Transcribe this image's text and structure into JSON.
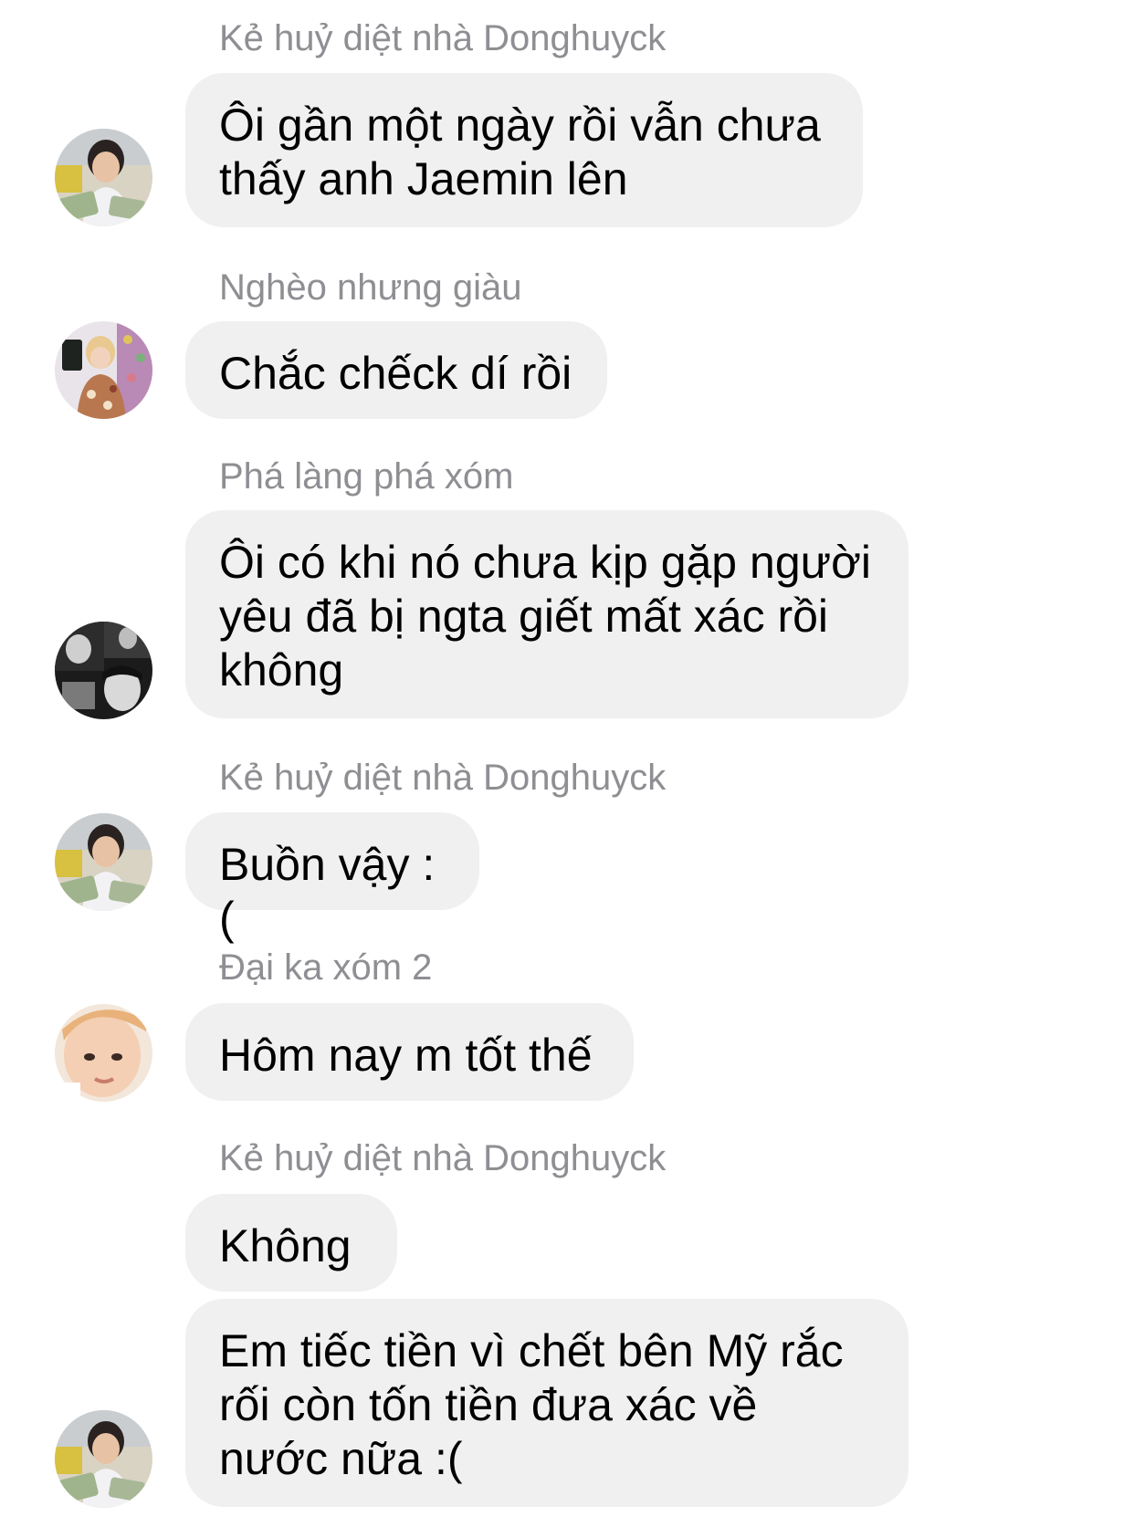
{
  "messages": [
    {
      "sender": "Kẻ huỷ diệt nhà Donghuyck",
      "avatar": "avatar-boy-with-money",
      "bubbles": [
        "Ôi gần một ngày rồi vẫn chưa thấy anh Jaemin lên"
      ]
    },
    {
      "sender": "Nghèo nhưng giàu",
      "avatar": "avatar-idol-floral-shirt",
      "bubbles": [
        "Chắc chếck dí rồi"
      ]
    },
    {
      "sender": "Phá làng phá xóm",
      "avatar": "avatar-bw-collage",
      "bubbles": [
        "Ôi có khi nó chưa kịp gặp người yêu đã bị ngta giết mất xác rồi không"
      ]
    },
    {
      "sender": "Kẻ huỷ diệt nhà Donghuyck",
      "avatar": "avatar-boy-with-money",
      "bubbles": [
        "Buồn vậy :("
      ]
    },
    {
      "sender": "Đại ka xóm 2",
      "avatar": "avatar-boy-closeup",
      "bubbles": [
        "Hôm nay m tốt thế"
      ]
    },
    {
      "sender": "Kẻ huỷ diệt nhà Donghuyck",
      "avatar": "avatar-boy-with-money",
      "bubbles": [
        "Không",
        "Em tiếc tiền vì chết bên Mỹ rắc rối còn tốn tiền đưa xác về nước nữa :("
      ]
    }
  ],
  "colors": {
    "bubble_bg": "#f0f0f0",
    "sender_text": "#8e8e93",
    "message_text": "#000000"
  }
}
